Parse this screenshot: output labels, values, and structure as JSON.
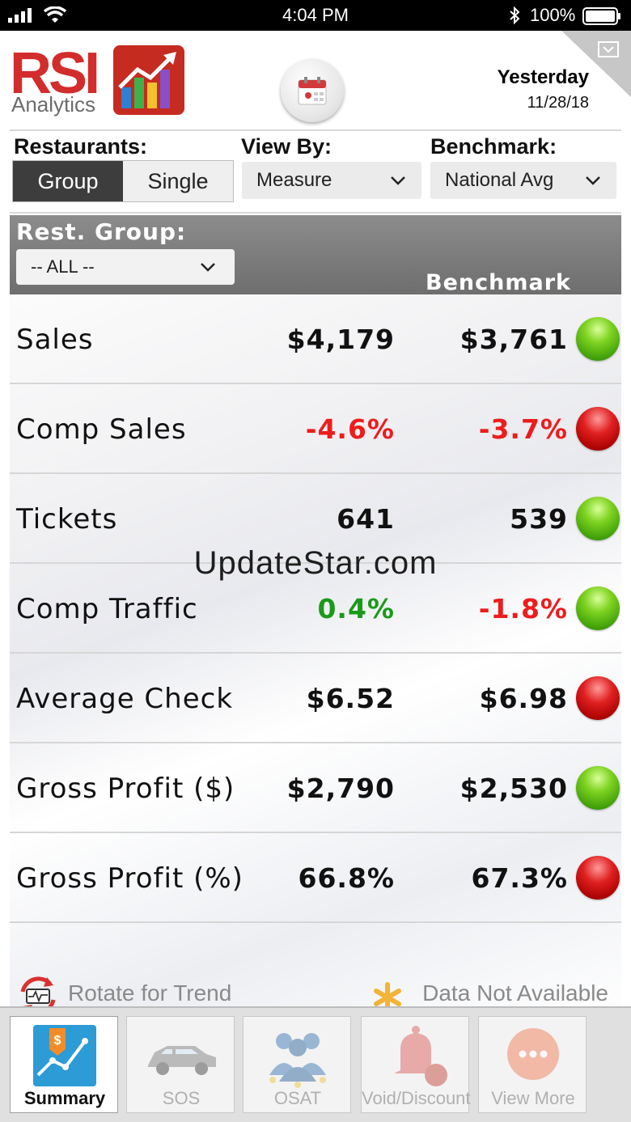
{
  "status_bar": {
    "time": "4:04 PM",
    "battery_pct": "100%"
  },
  "header": {
    "logo_text": "RSI",
    "logo_subtext": "Analytics",
    "day_label": "Yesterday",
    "date": "11/28/18"
  },
  "controls": {
    "restaurants_label": "Restaurants:",
    "group_label": "Group",
    "single_label": "Single",
    "view_by_label": "View By:",
    "view_by_value": "Measure",
    "benchmark_label": "Benchmark:",
    "benchmark_value": "National Avg"
  },
  "table": {
    "rest_group_label": "Rest. Group:",
    "rest_group_value": "-- ALL --",
    "benchmark_header": "Benchmark",
    "rows": [
      {
        "name": "Sales",
        "value": "$4,179",
        "value_color": "#111111",
        "benchmark": "$3,761",
        "benchmark_color": "#111111",
        "status": "green"
      },
      {
        "name": "Comp Sales",
        "value": "-4.6%",
        "value_color": "#ee1c1c",
        "benchmark": "-3.7%",
        "benchmark_color": "#ee1c1c",
        "status": "red"
      },
      {
        "name": "Tickets",
        "value": "641",
        "value_color": "#111111",
        "benchmark": "539",
        "benchmark_color": "#111111",
        "status": "green"
      },
      {
        "name": "Comp Traffic",
        "value": "0.4%",
        "value_color": "#1a9a1a",
        "benchmark": "-1.8%",
        "benchmark_color": "#ee1c1c",
        "status": "green"
      },
      {
        "name": "Average Check",
        "value": "$6.52",
        "value_color": "#111111",
        "benchmark": "$6.98",
        "benchmark_color": "#111111",
        "status": "red"
      },
      {
        "name": "Gross Profit ($)",
        "value": "$2,790",
        "value_color": "#111111",
        "benchmark": "$2,530",
        "benchmark_color": "#111111",
        "status": "green"
      },
      {
        "name": "Gross Profit (%)",
        "value": "66.8%",
        "value_color": "#111111",
        "benchmark": "67.3%",
        "benchmark_color": "#111111",
        "status": "red"
      }
    ]
  },
  "legend": {
    "rotate_text": "Rotate for Trend",
    "na_text": "Data Not Available"
  },
  "watermark": "UpdateStar.com",
  "tabs": [
    {
      "label": "Summary",
      "icon": "summary-chart-icon",
      "active": true
    },
    {
      "label": "SOS",
      "icon": "car-icon",
      "active": false
    },
    {
      "label": "OSAT",
      "icon": "people-stars-icon",
      "active": false
    },
    {
      "label": "Void/Discount",
      "icon": "bell-icon",
      "active": false
    },
    {
      "label": "View More",
      "icon": "more-dots-icon",
      "active": false
    }
  ]
}
